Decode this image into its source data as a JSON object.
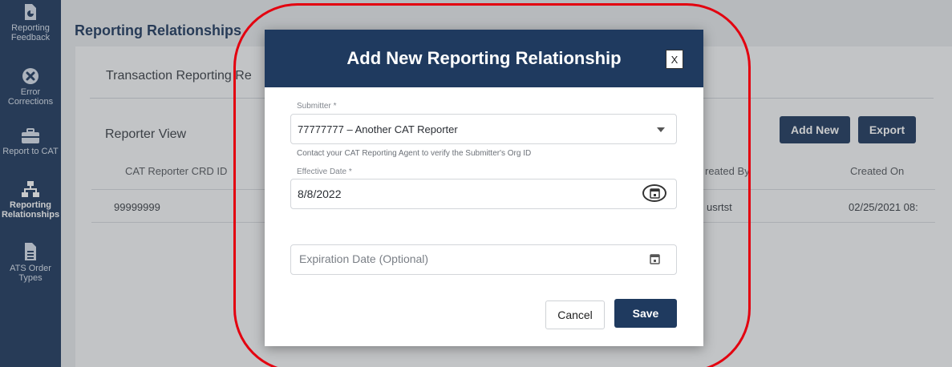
{
  "sidebar": {
    "items": [
      {
        "label_lines": [
          "Reporting",
          "Feedback"
        ],
        "icon": "report-chart-icon"
      },
      {
        "label_lines": [
          "Error",
          "Corrections"
        ],
        "icon": "error-x-icon"
      },
      {
        "label_lines": [
          "Report to CAT",
          ""
        ],
        "icon": "briefcase-icon"
      },
      {
        "label_lines": [
          "Reporting",
          "Relationships"
        ],
        "icon": "network-icon"
      },
      {
        "label_lines": [
          "ATS Order",
          "Types"
        ],
        "icon": "document-icon"
      }
    ]
  },
  "page": {
    "title": "Reporting Relationships",
    "subtitle": "Transaction Reporting Re",
    "section_title": "Reporter View",
    "add_new_label": "Add New",
    "export_label": "Export",
    "table": {
      "columns": [
        "CAT Reporter CRD ID",
        "reated By",
        "Created On"
      ],
      "rows": [
        {
          "crd": "99999999",
          "created_by": "usrtst",
          "created_on": "02/25/2021 08:"
        }
      ]
    }
  },
  "modal": {
    "title": "Add New Reporting Relationship",
    "close_label": "X",
    "submitter": {
      "label": "Submitter *",
      "value": "77777777 – Another CAT Reporter",
      "hint": "Contact your CAT Reporting Agent to verify the Submitter's Org ID"
    },
    "effective_date": {
      "label": "Effective Date *",
      "value": "8/8/2022"
    },
    "expiration_date": {
      "placeholder": "Expiration Date (Optional)"
    },
    "cancel_label": "Cancel",
    "save_label": "Save"
  },
  "colors": {
    "brand_navy": "#1f3a5f",
    "highlight_red": "#e3000f"
  }
}
